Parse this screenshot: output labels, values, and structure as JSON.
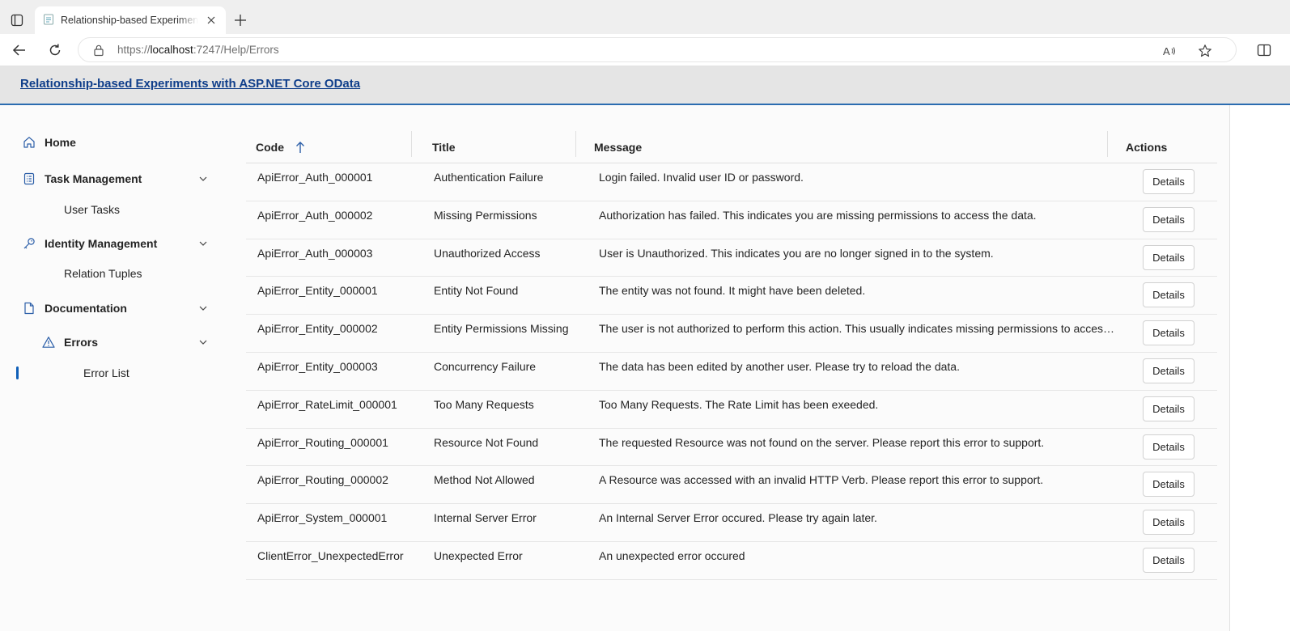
{
  "browser": {
    "tab_title": "Relationship-based Experiments with ASP.NET Core OData",
    "url_prefix": "https://",
    "url_host": "localhost",
    "url_path": ":7247/Help/Errors"
  },
  "app": {
    "title": "Relationship-based Experiments with ASP.NET Core OData"
  },
  "sidebar": {
    "home": "Home",
    "task_management": "Task Management",
    "user_tasks": "User Tasks",
    "identity_management": "Identity Management",
    "relation_tuples": "Relation Tuples",
    "documentation": "Documentation",
    "errors": "Errors",
    "error_list": "Error List"
  },
  "grid": {
    "columns": {
      "code": "Code",
      "title": "Title",
      "message": "Message",
      "actions": "Actions"
    },
    "details_label": "Details",
    "rows": [
      {
        "code": "ApiError_Auth_000001",
        "title": "Authentication Failure",
        "message": "Login failed. Invalid user ID or password."
      },
      {
        "code": "ApiError_Auth_000002",
        "title": "Missing Permissions",
        "message": "Authorization has failed. This indicates you are missing permissions to access the data."
      },
      {
        "code": "ApiError_Auth_000003",
        "title": "Unauthorized Access",
        "message": "User is Unauthorized. This indicates you are no longer signed in to the system."
      },
      {
        "code": "ApiError_Entity_000001",
        "title": "Entity Not Found",
        "message": "The entity was not found. It might have been deleted."
      },
      {
        "code": "ApiError_Entity_000002",
        "title": "Entity Permissions Missing",
        "message": "The user is not authorized to perform this action. This usually indicates missing permissions to access the data."
      },
      {
        "code": "ApiError_Entity_000003",
        "title": "Concurrency Failure",
        "message": "The data has been edited by another user. Please try to reload the data."
      },
      {
        "code": "ApiError_RateLimit_000001",
        "title": "Too Many Requests",
        "message": "Too Many Requests. The Rate Limit has been exeeded."
      },
      {
        "code": "ApiError_Routing_000001",
        "title": "Resource Not Found",
        "message": "The requested Resource was not found on the server. Please report this error to support."
      },
      {
        "code": "ApiError_Routing_000002",
        "title": "Method Not Allowed",
        "message": "A Resource was accessed with an invalid HTTP Verb. Please report this error to support."
      },
      {
        "code": "ApiError_System_000001",
        "title": "Internal Server Error",
        "message": "An Internal Server Error occured. Please try again later."
      },
      {
        "code": "ClientError_UnexpectedError",
        "title": "Unexpected Error",
        "message": "An unexpected error occured"
      }
    ]
  }
}
